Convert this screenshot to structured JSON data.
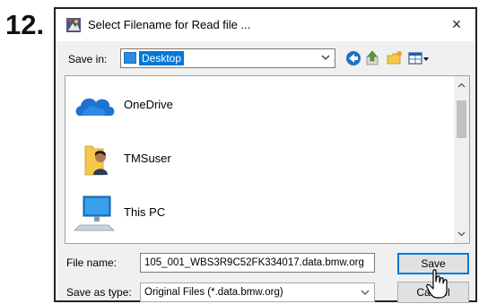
{
  "step": {
    "number": "12."
  },
  "dialog": {
    "title": "Select Filename for Read file ...",
    "close_glyph": "×"
  },
  "toolbar": {
    "save_in_label": "Save in:",
    "save_in_value": "Desktop",
    "icons": [
      "back-icon",
      "up-folder-icon",
      "new-folder-icon",
      "view-menu-icon"
    ]
  },
  "file_list": {
    "items": [
      {
        "label": "OneDrive",
        "icon": "onedrive-cloud-icon"
      },
      {
        "label": "TMSuser",
        "icon": "user-folder-icon"
      },
      {
        "label": "This PC",
        "icon": "computer-icon"
      }
    ]
  },
  "form": {
    "file_name_label": "File name:",
    "file_name_value": "105_001_WBS3R9C52FK334017.data.bmw.org",
    "save_as_type_label": "Save as type:",
    "save_as_type_value": "Original Files (*.data.bmw.org)",
    "save_button": "Save",
    "cancel_button": "Cancel"
  },
  "colors": {
    "selection": "#0078d7",
    "default_button_border": "#0078d7",
    "dialog_bg": "#f0f0f0"
  }
}
